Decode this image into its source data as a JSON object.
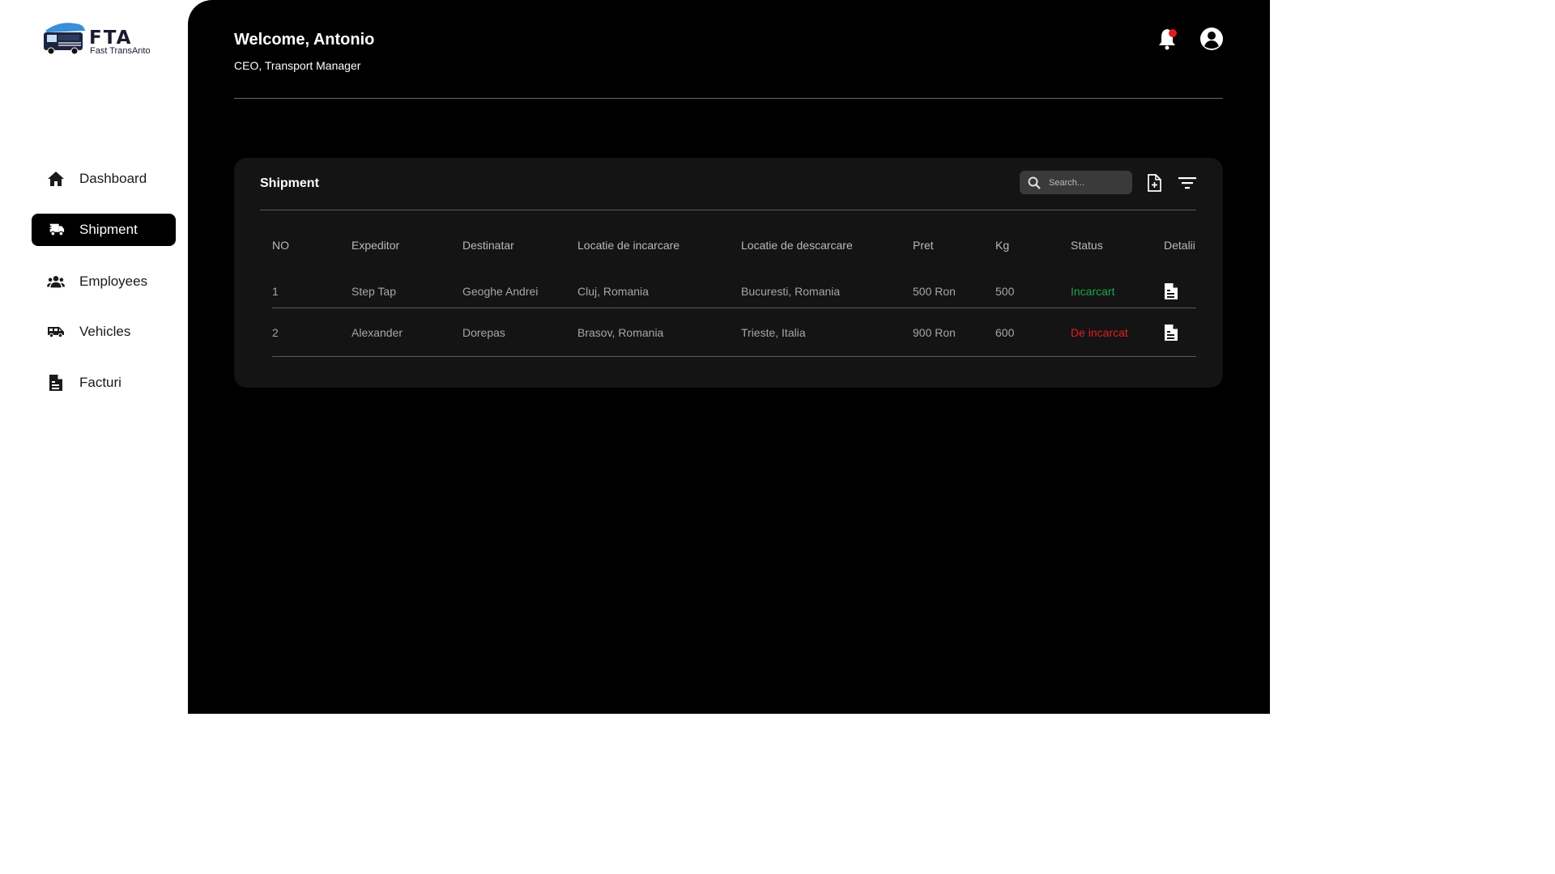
{
  "brand": {
    "name": "FTA",
    "subtitle": "Fast TransAnto"
  },
  "sidebar": {
    "items": [
      {
        "label": "Dashboard",
        "icon": "home-icon",
        "active": false
      },
      {
        "label": "Shipment",
        "icon": "truck-fast-icon",
        "active": true
      },
      {
        "label": "Employees",
        "icon": "users-icon",
        "active": false
      },
      {
        "label": "Vehicles",
        "icon": "van-icon",
        "active": false
      },
      {
        "label": "Facturi",
        "icon": "invoice-icon",
        "active": false
      }
    ]
  },
  "header": {
    "welcome": "Welcome, Antonio",
    "role": "CEO, Transport Manager",
    "notification_badge_color": "#e51b1b"
  },
  "shipment": {
    "title": "Shipment",
    "search_placeholder": "Search...",
    "columns": [
      "NO",
      "Expeditor",
      "Destinatar",
      "Locatie de incarcare",
      "Locatie de descarcare",
      "Pret",
      "Kg",
      "Status",
      "Detalii"
    ],
    "rows": [
      {
        "no": "1",
        "expeditor": "Step Tap",
        "destinatar": "Geoghe Andrei",
        "incarcare": "Cluj, Romania",
        "descarcare": "Bucuresti, Romania",
        "pret": "500 Ron",
        "kg": "500",
        "status": "Incarcart",
        "status_color": "#1aa64a"
      },
      {
        "no": "2",
        "expeditor": "Alexander",
        "destinatar": "Dorepas",
        "incarcare": "Brasov, Romania",
        "descarcare": "Trieste, Italia",
        "pret": "900 Ron",
        "kg": "600",
        "status": "De incarcat",
        "status_color": "#e01f1f"
      }
    ]
  }
}
